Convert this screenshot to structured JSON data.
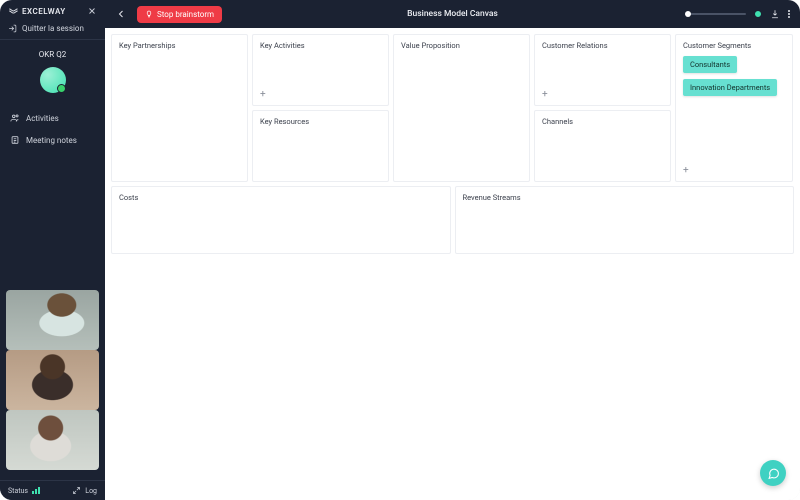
{
  "brand": {
    "name": "EXCELWAY"
  },
  "sidebar": {
    "quit_label": "Quitter la session",
    "session_name": "OKR Q2",
    "nav": [
      {
        "label": "Activities"
      },
      {
        "label": "Meeting notes"
      }
    ],
    "status_label": "Status",
    "log_label": "Log"
  },
  "topbar": {
    "stop_label": "Stop brainstorm",
    "title": "Business Model Canvas"
  },
  "canvas": {
    "key_partnerships": "Key Partnerships",
    "key_activities": "Key Activities",
    "key_resources": "Key Resources",
    "value_proposition": "Value Proposition",
    "customer_relations": "Customer Relations",
    "channels": "Channels",
    "customer_segments": "Customer Segments",
    "costs": "Costs",
    "revenue_streams": "Revenue Streams",
    "segments_cards": [
      "Consultants",
      "Innovation Departments"
    ]
  },
  "glyphs": {
    "plus": "+"
  }
}
